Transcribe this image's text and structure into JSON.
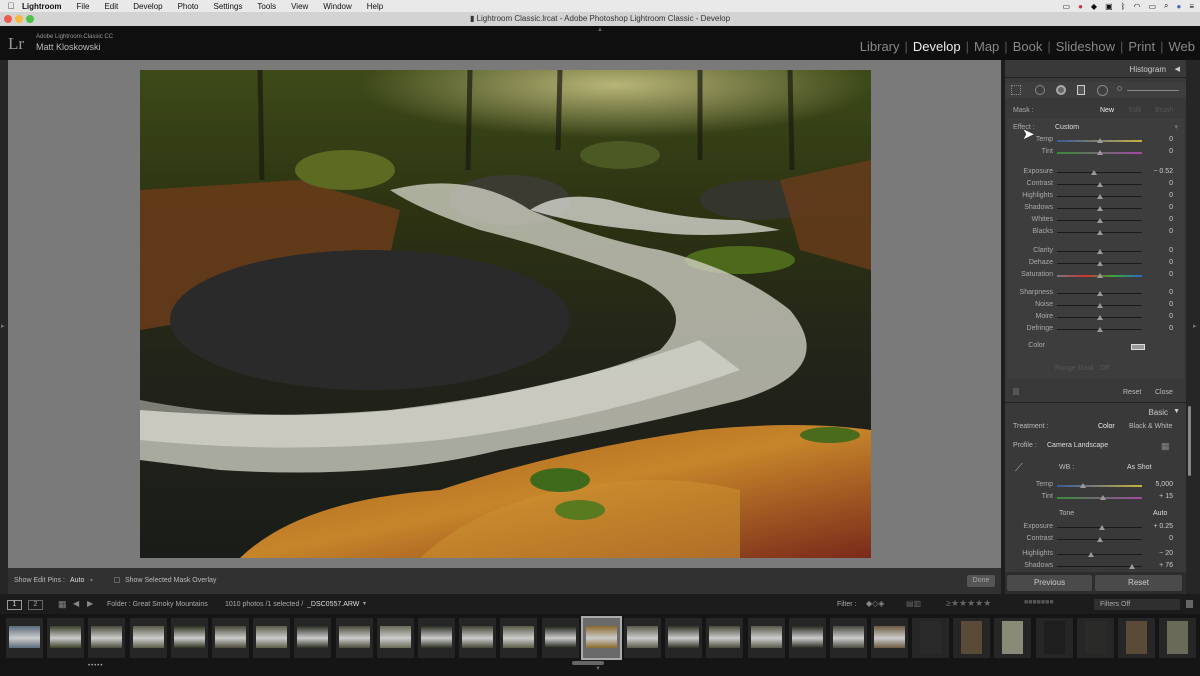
{
  "menubar": {
    "apple": "",
    "items": [
      "Lightroom",
      "File",
      "Edit",
      "Develop",
      "Photo",
      "Settings",
      "Tools",
      "View",
      "Window",
      "Help"
    ]
  },
  "window": {
    "title": "Lightroom Classic.lrcat - Adobe Photoshop Lightroom Classic - Develop"
  },
  "identity": {
    "logo": "Lr",
    "app": "Adobe Lightroom Classic CC",
    "user": "Matt Kloskowski"
  },
  "modules": [
    "Library",
    "Develop",
    "Map",
    "Book",
    "Slideshow",
    "Print",
    "Web"
  ],
  "active_module": "Develop",
  "toolbar": {
    "show_edit_pins_label": "Show Edit Pins :",
    "show_edit_pins_value": "Auto",
    "show_overlay_label": "Show Selected Mask Overlay",
    "done": "Done"
  },
  "right_panel": {
    "histogram": "Histogram",
    "mask_label": "Mask :",
    "mask_new": "New",
    "mask_edit": "Edit",
    "mask_brush": "Brush",
    "effect_label": "Effect :",
    "effect_value": "Custom",
    "sliders_group1": [
      {
        "label": "Temp",
        "value": "0",
        "pos": 0.5
      },
      {
        "label": "Tint",
        "value": "0",
        "pos": 0.5
      }
    ],
    "sliders_group2": [
      {
        "label": "Exposure",
        "value": "− 0.52",
        "pos": 0.44
      },
      {
        "label": "Contrast",
        "value": "0",
        "pos": 0.5
      },
      {
        "label": "Highlights",
        "value": "0",
        "pos": 0.5
      },
      {
        "label": "Shadows",
        "value": "0",
        "pos": 0.5
      },
      {
        "label": "Whites",
        "value": "0",
        "pos": 0.5
      },
      {
        "label": "Blacks",
        "value": "0",
        "pos": 0.5
      }
    ],
    "sliders_group3": [
      {
        "label": "Clarity",
        "value": "0",
        "pos": 0.5
      },
      {
        "label": "Dehaze",
        "value": "0",
        "pos": 0.5
      },
      {
        "label": "Saturation",
        "value": "0",
        "pos": 0.5
      }
    ],
    "sliders_group4": [
      {
        "label": "Sharpness",
        "value": "0",
        "pos": 0.5
      },
      {
        "label": "Noise",
        "value": "0",
        "pos": 0.5
      },
      {
        "label": "Moire",
        "value": "0",
        "pos": 0.5
      },
      {
        "label": "Defringe",
        "value": "0",
        "pos": 0.5
      }
    ],
    "color_label": "Color",
    "range_mask": "Range Mask : Off",
    "reset": "Reset",
    "close": "Close",
    "basic": "Basic",
    "treatment_label": "Treatment :",
    "treatment_color": "Color",
    "treatment_bw": "Black & White",
    "profile_label": "Profile :",
    "profile_value": "Camera Landscape",
    "wb_label": "WB :",
    "wb_value": "As Shot",
    "basic_wb": [
      {
        "label": "Temp",
        "value": "5,000",
        "pos": 0.3
      },
      {
        "label": "Tint",
        "value": "+ 15",
        "pos": 0.54
      }
    ],
    "tone_label": "Tone",
    "tone_auto": "Auto",
    "basic_tone": [
      {
        "label": "Exposure",
        "value": "+ 0.25",
        "pos": 0.53
      },
      {
        "label": "Contrast",
        "value": "0",
        "pos": 0.5
      }
    ],
    "basic_tone2": [
      {
        "label": "Highlights",
        "value": "− 20",
        "pos": 0.4
      },
      {
        "label": "Shadows",
        "value": "+ 76",
        "pos": 0.88
      }
    ],
    "previous": "Previous",
    "reset_bottom": "Reset"
  },
  "filmbar": {
    "page1": "1",
    "page2": "2",
    "folder": "Folder : Great Smoky Mountains",
    "count": "1010 photos /1 selected /",
    "filename": "_DSC0557.ARW",
    "filter_label": "Filter :",
    "filters_off": "Filters Off"
  },
  "colors": {
    "accent_panel": "#393939",
    "canvas": "#7a7a7a"
  }
}
